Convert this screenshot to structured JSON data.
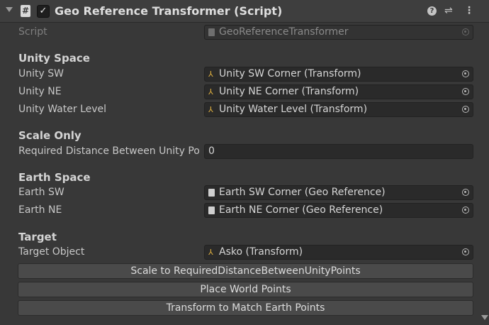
{
  "header": {
    "title": "Geo Reference Transformer (Script)",
    "enabled": true,
    "icons": [
      "foldout-arrow-icon",
      "script-icon",
      "checkbox-icon",
      "help-icon",
      "presets-icon",
      "kebab-menu-icon"
    ]
  },
  "script_row": {
    "label": "Script",
    "value": "GeoReferenceTransformer"
  },
  "unity_space": {
    "heading": "Unity Space",
    "fields": [
      {
        "label": "Unity SW",
        "value": "Unity SW Corner (Transform)"
      },
      {
        "label": "Unity NE",
        "value": "Unity NE Corner (Transform)"
      },
      {
        "label": "Unity Water Level",
        "value": "Unity Water Level (Transform)"
      }
    ]
  },
  "scale_only": {
    "heading": "Scale Only",
    "label": "Required Distance Between Unity Po",
    "value": "0"
  },
  "earth_space": {
    "heading": "Earth Space",
    "fields": [
      {
        "label": "Earth SW",
        "value": "Earth SW Corner (Geo Reference)"
      },
      {
        "label": "Earth NE",
        "value": "Earth NE Corner (Geo Reference)"
      }
    ]
  },
  "target": {
    "heading": "Target",
    "label": "Target Object",
    "value": "Asko (Transform)"
  },
  "buttons": [
    "Scale to RequiredDistanceBetweenUnityPoints",
    "Place World Points",
    "Transform to Match Earth Points"
  ]
}
